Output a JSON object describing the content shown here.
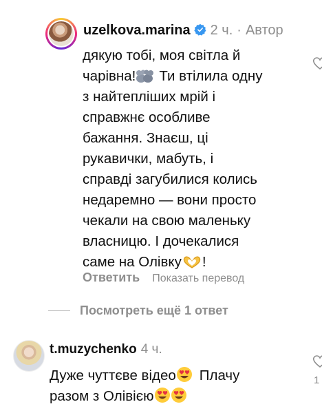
{
  "comment1": {
    "username": "uzelkova.marina",
    "time": "2 ч.",
    "separator": "·",
    "author_label": "Автор",
    "lines": [
      "дякую тобі, моя світла й",
      "чарівна!",
      "Ти втілила одну",
      "з найтепліших мрій і",
      "справжнє особливе",
      "бажання. Знаєш, ці",
      "рукавички, мабуть, і",
      "справді загубилися колись",
      "недаремно — вони просто",
      "чекали на свою маленьку",
      "власницю. І дочекалися",
      "саме на Олівку",
      "!"
    ],
    "reply_label": "Ответить",
    "translate_label": "Показать перевод"
  },
  "view_replies": "Посмотреть ещё 1 ответ",
  "comment2": {
    "username": "t.muzychenko",
    "time": "4 ч.",
    "line1": "Дуже чуттєве відео",
    "line1b": "Плачу",
    "line2": "разом з Олівією"
  },
  "edge_like_count": "1",
  "icons": [
    "verified-badge-icon",
    "mice-emoji-icon",
    "heart-hands-emoji-icon",
    "heart-eyes-emoji-icon",
    "like-heart-icon"
  ],
  "colors": {
    "text": "#111111",
    "secondary": "#8e8e8e",
    "verified": "#3897f0"
  }
}
